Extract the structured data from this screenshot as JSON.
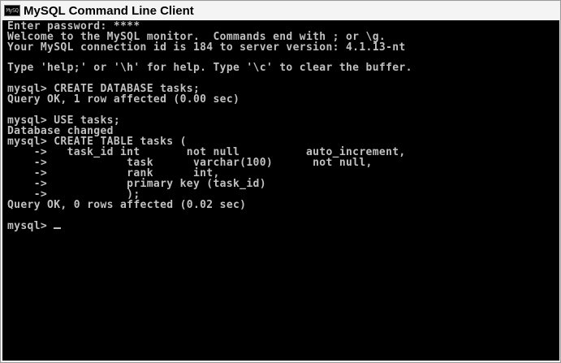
{
  "window": {
    "title": "MySQL Command Line Client",
    "icon": "console-icon",
    "icon_text": "MySQ"
  },
  "console": {
    "lines": [
      "Enter password: ****",
      "Welcome to the MySQL monitor.  Commands end with ; or \\g.",
      "Your MySQL connection id is 184 to server version: 4.1.13-nt",
      "",
      "Type 'help;' or '\\h' for help. Type '\\c' to clear the buffer.",
      "",
      "mysql> CREATE DATABASE tasks;",
      "Query OK, 1 row affected (0.00 sec)",
      "",
      "mysql> USE tasks;",
      "Database changed",
      "mysql> CREATE TABLE tasks (",
      "    ->   task_id int       not null          auto_increment,",
      "    ->            task      varchar(100)      not null,",
      "    ->            rank      int,",
      "    ->            primary key (task_id)",
      "    ->            );",
      "Query OK, 0 rows affected (0.02 sec)",
      "",
      "mysql> "
    ],
    "text_color": "#c0c0c0",
    "background_color": "#000000"
  }
}
